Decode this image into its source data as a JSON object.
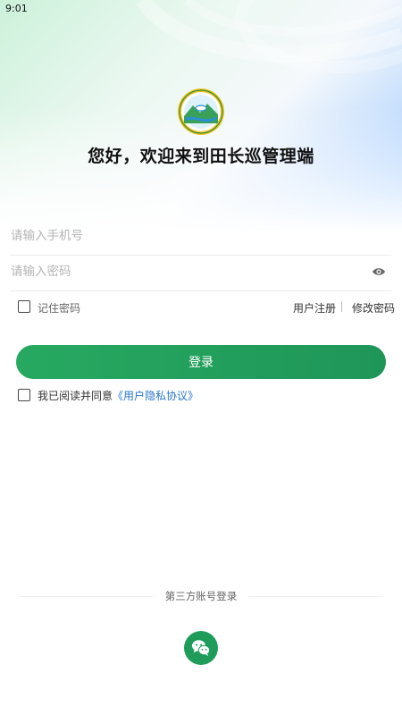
{
  "status_bar": {
    "time": "9:01"
  },
  "header": {
    "welcome": "您好，欢迎来到田长巡管理端"
  },
  "form": {
    "phone_placeholder": "请输入手机号",
    "password_placeholder": "请输入密码",
    "remember_label": "记住密码",
    "register_label": "用户注册",
    "change_password_label": "修改密码",
    "login_label": "登录",
    "agree_prefix": "我已阅读并同意",
    "agree_link": "《用户隐私协议》"
  },
  "third_party": {
    "label": "第三方账号登录",
    "wechat_icon": "wechat-icon"
  },
  "colors": {
    "primary": "#23a35e",
    "link": "#2a76c8"
  }
}
